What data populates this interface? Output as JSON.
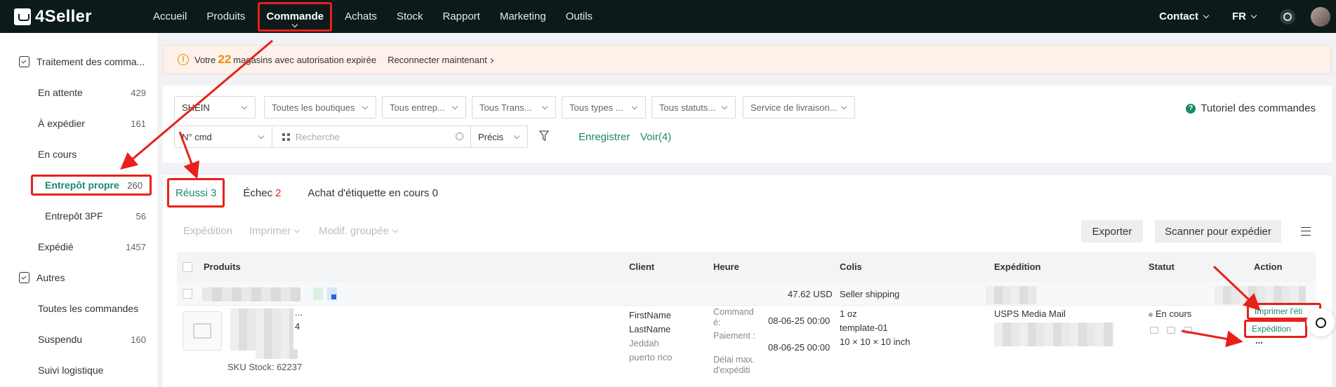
{
  "brand": {
    "name": "4Seller"
  },
  "topnav": {
    "items": [
      "Accueil",
      "Produits",
      "Commande",
      "Achats",
      "Stock",
      "Rapport",
      "Marketing",
      "Outils"
    ],
    "active_index": 2,
    "contact": "Contact",
    "language": "FR"
  },
  "sidebar": {
    "group1": "Traitement des comma...",
    "items": [
      {
        "label": "En attente",
        "count": "429"
      },
      {
        "label": "À expédier",
        "count": "161"
      },
      {
        "label": "En cours",
        "count": ""
      },
      {
        "label": "Entrepôt propre",
        "count": "260"
      },
      {
        "label": "Entrepôt 3PF",
        "count": "56"
      },
      {
        "label": "Expédié",
        "count": "1457"
      }
    ],
    "group2": "Autres",
    "items2": [
      {
        "label": "Toutes les commandes",
        "count": ""
      },
      {
        "label": "Suspendu",
        "count": "160"
      },
      {
        "label": "Suivi logistique",
        "count": ""
      }
    ]
  },
  "banner": {
    "prefix": "Votre",
    "count": "22",
    "suffix": "magasins avec autorisation expirée",
    "link": "Reconnecter maintenant"
  },
  "filters": {
    "platform": "SHEIN",
    "shops": "Toutes les boutiques",
    "warehouse": "Tous entrep...",
    "transport": "Tous Trans...",
    "types": "Tous types ...",
    "statuts": "Tous statuts...",
    "service": "Service de livraison...",
    "field": "N° cmd",
    "search_placeholder": "Recherche",
    "match": "Précis",
    "save": "Enregistrer",
    "view": "Voir(4)",
    "tutorial": "Tutoriel des commandes"
  },
  "tabs": [
    {
      "label": "Réussi",
      "count": "3"
    },
    {
      "label": "Échec",
      "count": "2"
    },
    {
      "label": "Achat d'étiquette en cours 0",
      "count": ""
    }
  ],
  "toolbar": {
    "expedition": "Expédition",
    "print": "Imprimer",
    "bulk": "Modif. groupée",
    "export": "Exporter",
    "scan": "Scanner pour expédier"
  },
  "table": {
    "headers": [
      "Produits",
      "Client",
      "Heure",
      "Colis",
      "Expédition",
      "Statut",
      "Action"
    ],
    "group_row": {
      "amount": "47.62 USD",
      "shipping": "Seller shipping"
    },
    "row": {
      "ellipsis": "...",
      "qty": "4",
      "sku": "SKU Stock: 62237",
      "client": [
        "FirstName",
        "LastName",
        "Jeddah",
        "puerto rico"
      ],
      "time_labels": [
        "Command é:",
        "Paiement :",
        "Délai max. d'expéditi"
      ],
      "time_values": [
        "08-06-25 00:00",
        "08-06-25 00:00"
      ],
      "colis": [
        "1 oz",
        "template-01",
        "10 × 10 × 10 inch"
      ],
      "expedition": "USPS Media Mail",
      "status": "En cours",
      "actions": [
        "Imprimer l'éti",
        "Expédition",
        "..."
      ]
    }
  }
}
